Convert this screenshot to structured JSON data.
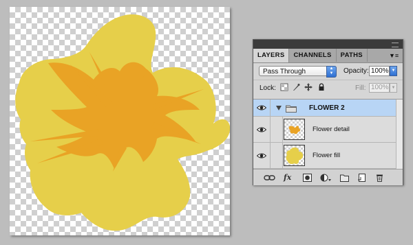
{
  "colors": {
    "petal": "#e6cf4a",
    "center": "#e9a325",
    "selection": "#b8d5f5",
    "accent": "#2e6fd2"
  },
  "panel": {
    "tabs": [
      {
        "label": "LAYERS",
        "active": true
      },
      {
        "label": "CHANNELS",
        "active": false
      },
      {
        "label": "PATHS",
        "active": false
      }
    ],
    "menu_icon": "panel-menu-icon",
    "blend_mode": "Pass Through",
    "opacity_label": "Opacity:",
    "opacity_value": "100%",
    "lock_label": "Lock:",
    "fill_label": "Fill:",
    "fill_value": "100%"
  },
  "layers": {
    "group": {
      "name": "FLOWER 2",
      "expanded": true,
      "visible": true
    },
    "children": [
      {
        "name": "Flower detail",
        "visible": true
      },
      {
        "name": "Flower fill",
        "visible": true
      }
    ]
  },
  "bottom_icons": [
    "link-layers-icon",
    "fx-icon",
    "add-mask-icon",
    "adjustment-layer-icon",
    "new-group-icon",
    "new-layer-icon",
    "delete-layer-icon"
  ]
}
